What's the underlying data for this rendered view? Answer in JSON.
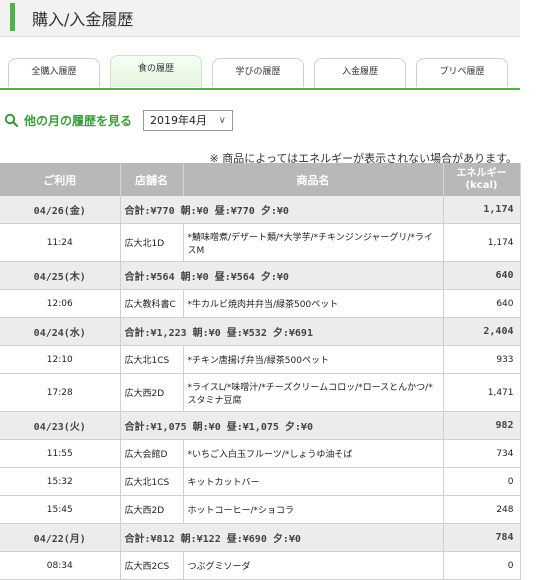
{
  "header": {
    "title": "購入/入金履歴"
  },
  "tabs": [
    "全購入履歴",
    "食の履歴",
    "学びの履歴",
    "入金履歴",
    "プリペ履歴"
  ],
  "month_link": "他の月の履歴を見る",
  "month_select": "2019年4月",
  "notice": "※ 商品によってはエネルギーが表示されない場合があります。",
  "columns": {
    "time": "ご利用",
    "shop": "店舗名",
    "item": "商品名",
    "kcal_1": "エネルギー",
    "kcal_2": "(kcal)"
  },
  "days": [
    {
      "date": "04/26(金)",
      "summary": "合計:¥770 朝:¥0 昼:¥770 夕:¥0",
      "kcal": "1,174",
      "items": [
        {
          "time": "11:24",
          "shop": "広大北1D",
          "name": "*鯖味噌煮/デザート類/*大学芋/*チキンジンジャーグリ/*ライスM",
          "kcal": "1,174"
        }
      ]
    },
    {
      "date": "04/25(木)",
      "summary": "合計:¥564 朝:¥0 昼:¥564 夕:¥0",
      "kcal": "640",
      "items": [
        {
          "time": "12:06",
          "shop": "広大教科書C",
          "name": "*牛カルビ焼肉丼弁当/緑茶500ペット",
          "kcal": "640"
        }
      ]
    },
    {
      "date": "04/24(水)",
      "summary": "合計:¥1,223 朝:¥0 昼:¥532 夕:¥691",
      "kcal": "2,404",
      "items": [
        {
          "time": "12:10",
          "shop": "広大北1CS",
          "name": "*チキン唐揚げ弁当/緑茶500ペット",
          "kcal": "933"
        },
        {
          "time": "17:28",
          "shop": "広大西2D",
          "name": "*ライスL/*味噌汁/*チーズクリームコロッ/*ロースとんかつ/*スタミナ豆腐",
          "kcal": "1,471"
        }
      ]
    },
    {
      "date": "04/23(火)",
      "summary": "合計:¥1,075 朝:¥0 昼:¥1,075 夕:¥0",
      "kcal": "982",
      "items": [
        {
          "time": "11:55",
          "shop": "広大会館D",
          "name": "*いちご入白玉フルーツ/*しょうゆ油そば",
          "kcal": "734"
        },
        {
          "time": "15:32",
          "shop": "広大北1CS",
          "name": "キットカットバー",
          "kcal": "0"
        },
        {
          "time": "15:45",
          "shop": "広大西2D",
          "name": "ホットコーヒー/*ショコラ",
          "kcal": "248"
        }
      ]
    },
    {
      "date": "04/22(月)",
      "summary": "合計:¥812 朝:¥122 昼:¥690 夕:¥0",
      "kcal": "784",
      "items": [
        {
          "time": "08:34",
          "shop": "広大西2CS",
          "name": "つぶグミソーダ",
          "kcal": "0"
        }
      ]
    }
  ]
}
